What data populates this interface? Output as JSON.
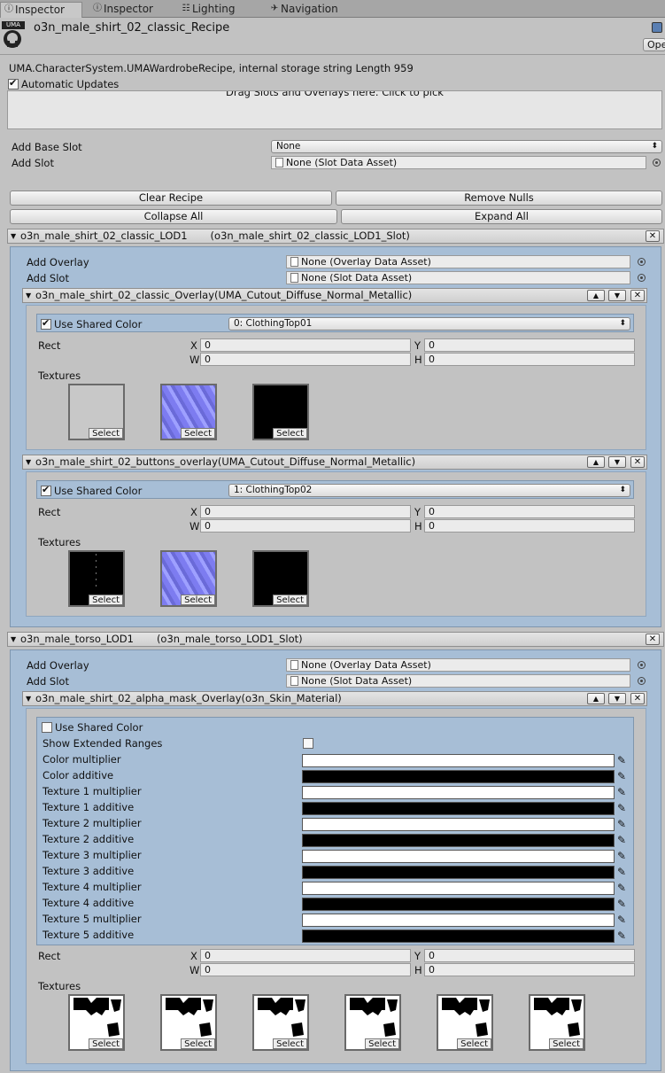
{
  "tabs": [
    {
      "label": "Inspector",
      "icon": "info-icon",
      "active": true
    },
    {
      "label": "Inspector",
      "icon": "info-icon",
      "active": false
    },
    {
      "label": "Lighting",
      "icon": "lighting-icon",
      "active": false
    },
    {
      "label": "Navigation",
      "icon": "navigation-icon",
      "active": false
    }
  ],
  "header": {
    "logo_text": "UMA",
    "title": "o3n_male_shirt_02_classic_Recipe",
    "open_label": "Open"
  },
  "info_line": "UMA.CharacterSystem.UMAWardrobeRecipe, internal storage string Length 959",
  "auto_updates": "Automatic Updates",
  "drop_hint": "Drag Slots and Overlays here. Click to pick",
  "add_base_slot": {
    "label": "Add Base Slot",
    "value": "None"
  },
  "add_slot": {
    "label": "Add Slot",
    "value": "None (Slot Data Asset)"
  },
  "buttons": {
    "clear": "Clear Recipe",
    "remove_nulls": "Remove Nulls",
    "collapse": "Collapse All",
    "expand": "Expand All"
  },
  "slots": [
    {
      "name": "o3n_male_shirt_02_classic_LOD1",
      "asset": "(o3n_male_shirt_02_classic_LOD1_Slot)",
      "add_overlay": {
        "label": "Add Overlay",
        "value": "None (Overlay Data Asset)"
      },
      "add_slot": {
        "label": "Add Slot",
        "value": "None (Slot Data Asset)"
      },
      "overlays": [
        {
          "name": "o3n_male_shirt_02_classic_Overlay(UMA_Cutout_Diffuse_Normal_Metallic)",
          "shared_label": "Use Shared Color",
          "shared_value": "0: ClothingTop01",
          "rect": {
            "label": "Rect",
            "x": "0",
            "y": "0",
            "w": "0",
            "h": "0"
          },
          "textures_label": "Textures",
          "textures": [
            {
              "kind": "plain-gray",
              "select": "Select"
            },
            {
              "kind": "normal-map",
              "select": "Select"
            },
            {
              "kind": "black",
              "select": "Select"
            }
          ]
        },
        {
          "name": "o3n_male_shirt_02_buttons_overlay(UMA_Cutout_Diffuse_Normal_Metallic)",
          "shared_label": "Use Shared Color",
          "shared_value": "1: ClothingTop02",
          "rect": {
            "label": "Rect",
            "x": "0",
            "y": "0",
            "w": "0",
            "h": "0"
          },
          "textures_label": "Textures",
          "textures": [
            {
              "kind": "black-dots",
              "select": "Select"
            },
            {
              "kind": "normal-map",
              "select": "Select"
            },
            {
              "kind": "black",
              "select": "Select"
            }
          ]
        }
      ]
    },
    {
      "name": "o3n_male_torso_LOD1",
      "asset": "(o3n_male_torso_LOD1_Slot)",
      "add_overlay": {
        "label": "Add Overlay",
        "value": "None (Overlay Data Asset)"
      },
      "add_slot": {
        "label": "Add Slot",
        "value": "None (Slot Data Asset)"
      },
      "overlay": {
        "name": "o3n_male_shirt_02_alpha_mask_Overlay(o3n_Skin_Material)",
        "shared_label": "Use Shared Color",
        "extended_label": "Show Extended Ranges",
        "colors": [
          {
            "label": "Color multiplier",
            "color": "#ffffff"
          },
          {
            "label": "Color additive",
            "color": "#000000"
          },
          {
            "label": "Texture 1 multiplier",
            "color": "#ffffff"
          },
          {
            "label": "Texture 1 additive",
            "color": "#000000"
          },
          {
            "label": "Texture 2 multiplier",
            "color": "#ffffff"
          },
          {
            "label": "Texture 2 additive",
            "color": "#000000"
          },
          {
            "label": "Texture 3 multiplier",
            "color": "#ffffff"
          },
          {
            "label": "Texture 3 additive",
            "color": "#000000"
          },
          {
            "label": "Texture 4 multiplier",
            "color": "#ffffff"
          },
          {
            "label": "Texture 4 additive",
            "color": "#000000"
          },
          {
            "label": "Texture 5 multiplier",
            "color": "#ffffff"
          },
          {
            "label": "Texture 5 additive",
            "color": "#000000"
          }
        ],
        "rect": {
          "label": "Rect",
          "x": "0",
          "y": "0",
          "w": "0",
          "h": "0"
        },
        "textures_label": "Textures",
        "textures": [
          {
            "kind": "mask",
            "select": "Select"
          },
          {
            "kind": "mask",
            "select": "Select"
          },
          {
            "kind": "mask",
            "select": "Select"
          },
          {
            "kind": "mask",
            "select": "Select"
          },
          {
            "kind": "mask",
            "select": "Select"
          },
          {
            "kind": "mask",
            "select": "Select"
          }
        ]
      }
    }
  ],
  "axis": {
    "x": "X",
    "y": "Y",
    "w": "W",
    "h": "H"
  }
}
